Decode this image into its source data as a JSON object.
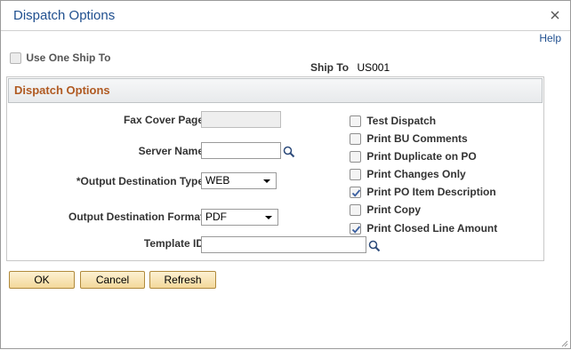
{
  "dialog": {
    "title": "Dispatch Options",
    "help_label": "Help"
  },
  "header": {
    "use_one_ship_to_label": "Use One Ship To",
    "use_one_ship_to_checked": false,
    "ship_to_label": "Ship To",
    "ship_to_value": "US001"
  },
  "panel": {
    "title": "Dispatch Options",
    "fields": {
      "fax_cover_page_label": "Fax Cover Page",
      "fax_cover_page_value": "",
      "server_name_label": "Server Name",
      "server_name_value": "",
      "output_destination_type_label": "*Output Destination Type",
      "output_destination_type_value": "WEB",
      "output_destination_format_label": "Output Destination Format",
      "output_destination_format_value": "PDF",
      "template_id_label": "Template ID",
      "template_id_value": ""
    },
    "checkboxes": [
      {
        "label": "Test Dispatch",
        "checked": false
      },
      {
        "label": "Print BU Comments",
        "checked": false
      },
      {
        "label": "Print Duplicate on PO",
        "checked": false
      },
      {
        "label": "Print Changes Only",
        "checked": false
      },
      {
        "label": "Print PO Item Description",
        "checked": true
      },
      {
        "label": "Print Copy",
        "checked": false
      },
      {
        "label": "Print Closed Line Amount",
        "checked": true
      }
    ]
  },
  "buttons": {
    "ok": "OK",
    "cancel": "Cancel",
    "refresh": "Refresh"
  },
  "icons": {
    "close": "close-icon",
    "lookup": "magnifier-icon",
    "check": "checkmark-icon",
    "dropdown": "chevron-down-icon",
    "resize": "resize-grip-icon"
  },
  "colors": {
    "title": "#1f4f8f",
    "panel_title": "#b05a22",
    "check": "#3a5fa0",
    "button_top": "#fdf1d3",
    "button_bottom": "#f3d89a"
  }
}
